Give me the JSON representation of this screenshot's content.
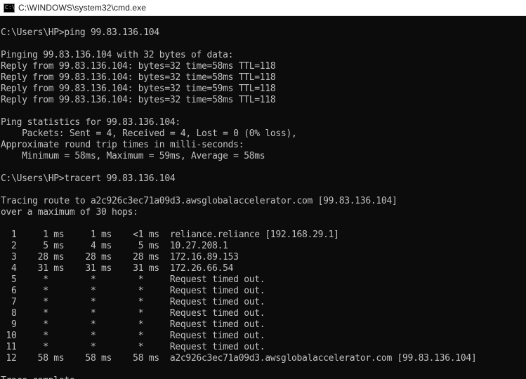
{
  "window": {
    "title": "C:\\WINDOWS\\system32\\cmd.exe",
    "icon": "cmd-prompt-icon",
    "background_color": "#0c0c0c",
    "text_color": "#c0c0c0"
  },
  "console": {
    "lines": [
      "",
      "C:\\Users\\HP>ping 99.83.136.104",
      "",
      "Pinging 99.83.136.104 with 32 bytes of data:",
      "Reply from 99.83.136.104: bytes=32 time=58ms TTL=118",
      "Reply from 99.83.136.104: bytes=32 time=58ms TTL=118",
      "Reply from 99.83.136.104: bytes=32 time=59ms TTL=118",
      "Reply from 99.83.136.104: bytes=32 time=58ms TTL=118",
      "",
      "Ping statistics for 99.83.136.104:",
      "    Packets: Sent = 4, Received = 4, Lost = 0 (0% loss),",
      "Approximate round trip times in milli-seconds:",
      "    Minimum = 58ms, Maximum = 59ms, Average = 58ms",
      "",
      "C:\\Users\\HP>tracert 99.83.136.104",
      "",
      "Tracing route to a2c926c3ec71a09d3.awsglobalaccelerator.com [99.83.136.104]",
      "over a maximum of 30 hops:",
      "",
      "  1     1 ms     1 ms    <1 ms  reliance.reliance [192.168.29.1]",
      "  2     5 ms     4 ms     5 ms  10.27.208.1",
      "  3    28 ms    28 ms    28 ms  172.16.89.153",
      "  4    31 ms    31 ms    31 ms  172.26.66.54",
      "  5     *        *        *     Request timed out.",
      "  6     *        *        *     Request timed out.",
      "  7     *        *        *     Request timed out.",
      "  8     *        *        *     Request timed out.",
      "  9     *        *        *     Request timed out.",
      " 10     *        *        *     Request timed out.",
      " 11     *        *        *     Request timed out.",
      " 12    58 ms    58 ms    58 ms  a2c926c3ec71a09d3.awsglobalaccelerator.com [99.83.136.104]",
      "",
      "Trace complete."
    ]
  }
}
